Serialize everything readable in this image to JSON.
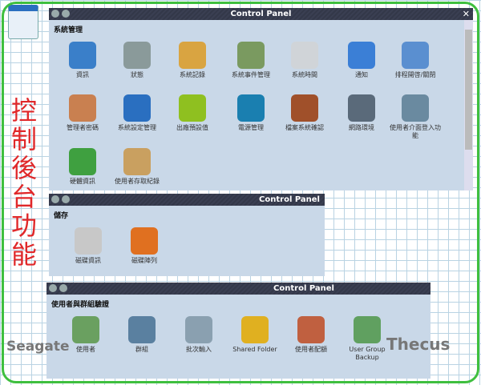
{
  "annotation": "控制後台功能",
  "panels": [
    {
      "title": "Control Panel",
      "section": "系統管理",
      "items": [
        "資訊",
        "狀態",
        "系統記錄",
        "系統事件管理",
        "系統時間",
        "通知",
        "排程開啓/關閉",
        "管理者密碼",
        "系統設定管理",
        "出廠預設值",
        "電源管理",
        "檔案系統確認",
        "網路環境",
        "使用者介面登入功能",
        "硬體資訊",
        "使用者存取紀錄"
      ]
    },
    {
      "title": "Control Panel",
      "section": "儲存",
      "items": [
        "磁碟資訊",
        "磁碟陣列"
      ]
    },
    {
      "title": "Control Panel",
      "section": "使用者與群組驗證",
      "items": [
        "使用者",
        "群組",
        "批次輸入",
        "Shared Folder",
        "使用者配額",
        "User Group Backup"
      ]
    }
  ],
  "watermarks": [
    "Seagate",
    "Thecus"
  ],
  "colors": {
    "icons": [
      "#3a7fc9",
      "#8a9a9a",
      "#d9a441",
      "#7a9a60",
      "#d0d4d8",
      "#3b7fd6",
      "#5a8fd0",
      "#c98050",
      "#2a6fc0",
      "#8fc020",
      "#1a7fb0",
      "#a0502a",
      "#5a6a7a",
      "#6a8aa0",
      "#3fa040",
      "#c9a060",
      "#c8c8c8",
      "#e07020",
      "#6aa060",
      "#5a80a0",
      "#8aa0b0",
      "#e0b020",
      "#c06040",
      "#60a060"
    ]
  }
}
